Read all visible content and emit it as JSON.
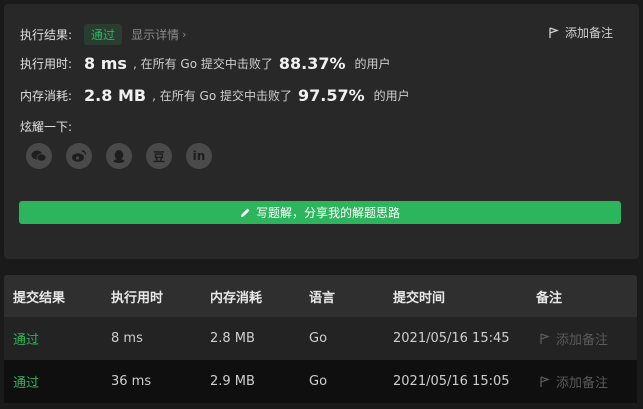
{
  "summary": {
    "result_label": "执行结果:",
    "result_badge": "通过",
    "detail_link": "显示详情",
    "detail_chevron": "›",
    "add_note": "添加备注",
    "time_label": "执行用时:",
    "time_value": "8 ms",
    "time_mid": ", 在所有 Go 提交中击败了",
    "time_pct": "88.37%",
    "time_tail": "的用户",
    "mem_label": "内存消耗:",
    "mem_value": "2.8 MB",
    "mem_mid": ", 在所有 Go 提交中击败了",
    "mem_pct": "97.57%",
    "mem_tail": "的用户",
    "share_label": "炫耀一下:",
    "share_icons": [
      "wechat-icon",
      "weibo-icon",
      "qq-icon",
      "douban-icon",
      "linkedin-icon"
    ],
    "douban_glyph": "豆",
    "linkedin_glyph": "in",
    "write_button": "写题解，分享我的解题思路"
  },
  "table": {
    "headers": [
      "提交结果",
      "执行用时",
      "内存消耗",
      "语言",
      "提交时间",
      "备注"
    ],
    "rows": [
      {
        "result": "通过",
        "time": "8 ms",
        "memory": "2.8 MB",
        "lang": "Go",
        "submitted": "2021/05/16 15:45",
        "note": "添加备注"
      },
      {
        "result": "通过",
        "time": "36 ms",
        "memory": "2.9 MB",
        "lang": "Go",
        "submitted": "2021/05/16 15:05",
        "note": "添加备注"
      }
    ]
  },
  "colors": {
    "accent": "#2db55d",
    "background": "#1a1a1a",
    "card": "#282828"
  }
}
